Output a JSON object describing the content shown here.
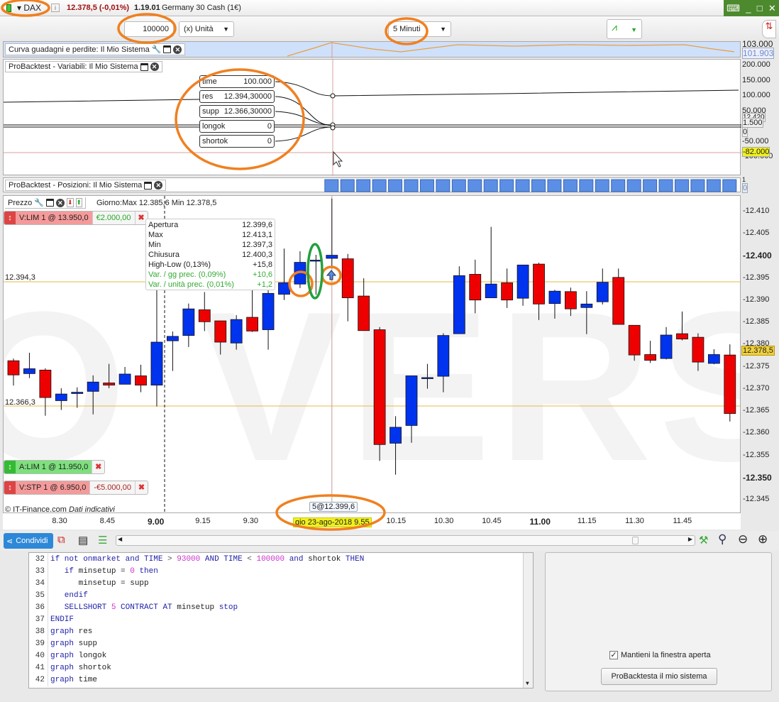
{
  "titlebar": {
    "instrument": "DAX",
    "price": "12.378,5 (-0,01%)",
    "time": "1.19.01",
    "description": "Germany 30 Cash (1€)"
  },
  "toolbar": {
    "quantity": "100000",
    "unit": "(x) Unità",
    "timeframe": "5 Minuti"
  },
  "equity_panel": {
    "title": "Curva guadagni e perdite: Il Mio Sistema",
    "axis_top": "103.000",
    "last_value": "101.903"
  },
  "variables_panel": {
    "title": "ProBacktest - Variabili: Il Mio Sistema",
    "vars": [
      {
        "name": "time",
        "value": "100.000"
      },
      {
        "name": "res",
        "value": "12.394,30000"
      },
      {
        "name": "supp",
        "value": "12.366,30000"
      },
      {
        "name": "longok",
        "value": "0"
      },
      {
        "name": "shortok",
        "value": "0"
      }
    ],
    "axis": [
      "200.000",
      "150.000",
      "100.000",
      "50.000",
      "-50.000",
      "-100.000"
    ],
    "boxes": {
      "a": "12.420",
      "b": "1.500",
      "c": "0",
      "cursor": "-82.000"
    }
  },
  "positions_panel": {
    "title": "ProBacktest - Posizioni: Il Mio Sistema",
    "axis_top": "1",
    "axis_box": "0"
  },
  "price_panel": {
    "title": "Prezzo",
    "day_info": "Giorno:Max 12.385,6 Min 12.378,5",
    "level_res": "12.394,3",
    "level_supp": "12.366,3",
    "orders": [
      {
        "label": "V:LIM  1 @ 13.950,0",
        "value": "€2.000,00"
      },
      {
        "label": "A:LIM  1 @ 11.950,0"
      },
      {
        "label": "V:STP  1 @ 6.950,0",
        "value": "-€5.000,00"
      }
    ],
    "tooltip": [
      {
        "k": "Apertura",
        "v": "12.399,6"
      },
      {
        "k": "Max",
        "v": "12.413,1"
      },
      {
        "k": "Min",
        "v": "12.397,3"
      },
      {
        "k": "Chiusura",
        "v": "12.400,3"
      },
      {
        "k": "High-Low (0,13%)",
        "v": "+15,8"
      },
      {
        "k": "Var. / gg prec. (0,09%)",
        "v": "+10,6"
      },
      {
        "k": "Var. / unità prec. (0,01%)",
        "v": "+1,2"
      }
    ],
    "copyright": "© IT-Finance.com",
    "disclaimer": "Dati indicativi",
    "order_marker": "5@12.399,6",
    "cursor_date": "gio 23-ago-2018 9.55",
    "last_price": "12.378,5",
    "watermark": "O VERSIO"
  },
  "chart_data": {
    "type": "candlestick",
    "ylim": [
      12343,
      12412
    ],
    "yticks": [
      "12.410",
      "12.405",
      "12.400",
      "12.395",
      "12.390",
      "12.385",
      "12.380",
      "12.375",
      "12.370",
      "12.365",
      "12.360",
      "12.355",
      "12.350",
      "12.345"
    ],
    "ytick_values": [
      12410,
      12405,
      12400,
      12395,
      12390,
      12385,
      12380,
      12375,
      12370,
      12365,
      12360,
      12355,
      12350,
      12345
    ],
    "xticks": [
      {
        "label": "8.30",
        "bar": 3
      },
      {
        "label": "8.45",
        "bar": 6
      },
      {
        "label": "9.00",
        "bar": 9,
        "bold": true
      },
      {
        "label": "9.15",
        "bar": 12
      },
      {
        "label": "9.30",
        "bar": 15
      },
      {
        "label": "10.15",
        "bar": 24
      },
      {
        "label": "10.30",
        "bar": 27
      },
      {
        "label": "10.45",
        "bar": 30
      },
      {
        "label": "11.00",
        "bar": 33,
        "bold": true
      },
      {
        "label": "11.15",
        "bar": 36
      },
      {
        "label": "11.30",
        "bar": 39
      },
      {
        "label": "11.45",
        "bar": 42
      }
    ],
    "ohlc": [
      [
        12376.5,
        12377.0,
        12370.9,
        12373.3
      ],
      [
        12373.6,
        12378.3,
        12372.6,
        12374.7
      ],
      [
        12374.4,
        12374.8,
        12364.1,
        12368.2
      ],
      [
        12367.5,
        12370.3,
        12365.4,
        12369.0
      ],
      [
        12369.1,
        12370.5,
        12365.9,
        12369.4
      ],
      [
        12369.6,
        12373.2,
        12364.4,
        12371.7
      ],
      [
        12371.5,
        12375.8,
        12370.3,
        12371.0
      ],
      [
        12371.2,
        12375.1,
        12371.2,
        12373.5
      ],
      [
        12373.1,
        12375.6,
        12369.4,
        12371.0
      ],
      [
        12371.0,
        12392.9,
        12366.2,
        12380.7
      ],
      [
        12381.0,
        12383.1,
        12374.2,
        12382.0
      ],
      [
        12382.2,
        12389.4,
        12379.6,
        12388.2
      ],
      [
        12388.0,
        12392.0,
        12383.2,
        12385.3
      ],
      [
        12385.5,
        12385.5,
        12377.9,
        12380.7
      ],
      [
        12380.5,
        12386.8,
        12379.0,
        12385.8
      ],
      [
        12386.3,
        12392.5,
        12383.0,
        12383.2
      ],
      [
        12383.5,
        12394.0,
        12379.0,
        12391.7
      ],
      [
        12391.5,
        12401.8,
        12390.2,
        12394.1
      ],
      [
        12393.8,
        12401.2,
        12392.9,
        12398.7
      ],
      [
        12399.0,
        12400.4,
        12391.4,
        12399.2
      ],
      [
        12399.6,
        12413.1,
        12397.3,
        12400.3
      ],
      [
        12399.5,
        12400.6,
        12385.4,
        12390.7
      ],
      [
        12391.1,
        12395.1,
        12383.3,
        12383.3
      ],
      [
        12383.5,
        12384.1,
        12353.9,
        12357.6
      ],
      [
        12357.9,
        12364.0,
        12350.8,
        12361.5
      ],
      [
        12361.9,
        12373.1,
        12358.0,
        12373.1
      ],
      [
        12372.7,
        12375.8,
        12370.2,
        12372.7
      ],
      [
        12373.0,
        12382.7,
        12369.4,
        12382.2
      ],
      [
        12382.6,
        12397.8,
        12382.6,
        12395.7
      ],
      [
        12396.0,
        12399.3,
        12387.2,
        12390.2
      ],
      [
        12390.7,
        12406.7,
        12390.7,
        12393.8
      ],
      [
        12394.1,
        12397.3,
        12388.4,
        12390.2
      ],
      [
        12390.6,
        12398.1,
        12388.9,
        12398.1
      ],
      [
        12398.3,
        12398.6,
        12385.7,
        12389.3
      ],
      [
        12389.4,
        12392.5,
        12386.0,
        12392.2
      ],
      [
        12392.1,
        12393.0,
        12386.6,
        12388.2
      ],
      [
        12388.5,
        12392.2,
        12382.5,
        12389.3
      ],
      [
        12389.8,
        12397.3,
        12389.2,
        12394.2
      ],
      [
        12395.3,
        12397.3,
        12384.7,
        12384.7
      ],
      [
        12384.5,
        12384.5,
        12376.5,
        12377.8
      ],
      [
        12377.9,
        12381.0,
        12376.0,
        12376.6
      ],
      [
        12377.0,
        12384.1,
        12376.8,
        12382.3
      ],
      [
        12382.6,
        12387.6,
        12381.1,
        12381.4
      ],
      [
        12381.8,
        12382.7,
        12374.2,
        12376.2
      ],
      [
        12375.9,
        12379.1,
        12375.7,
        12377.9
      ],
      [
        12377.8,
        12380.2,
        12362.8,
        12364.6
      ]
    ],
    "levels": {
      "res": 12394.3,
      "supp": 12366.3,
      "last": 12378.5
    },
    "colors": {
      "up": "#0033ee",
      "down": "#ee0000",
      "level": "#e8b84a"
    }
  },
  "bottom_toolbar": {
    "share": "Condividi"
  },
  "code": [
    {
      "n": "32",
      "t": [
        [
          "if",
          "kw"
        ],
        [
          " not onmarket ",
          "kw"
        ],
        [
          "and",
          "kw"
        ],
        [
          " TIME ",
          "kw"
        ],
        [
          "> ",
          "op"
        ],
        [
          "93000",
          "num"
        ],
        [
          " AND TIME ",
          "kw"
        ],
        [
          "< ",
          "op"
        ],
        [
          "100000",
          "num"
        ],
        [
          " and ",
          "kw"
        ],
        [
          "shortok ",
          "id"
        ],
        [
          "THEN",
          "kw"
        ]
      ]
    },
    {
      "n": "33",
      "t": [
        [
          "   if ",
          "kw"
        ],
        [
          "minsetup = ",
          "id"
        ],
        [
          "0",
          "num"
        ],
        [
          " then",
          "kw"
        ]
      ]
    },
    {
      "n": "34",
      "t": [
        [
          "      minsetup = supp",
          "id"
        ]
      ]
    },
    {
      "n": "35",
      "t": [
        [
          "   endif",
          "kw"
        ]
      ]
    },
    {
      "n": "36",
      "t": [
        [
          "   SELLSHORT ",
          "kw"
        ],
        [
          "5",
          "num"
        ],
        [
          " CONTRACT AT ",
          "kw"
        ],
        [
          "minsetup ",
          "id"
        ],
        [
          "stop",
          "kw"
        ]
      ]
    },
    {
      "n": "37",
      "t": [
        [
          "ENDIF",
          "kw"
        ]
      ]
    },
    {
      "n": "38",
      "t": [
        [
          "graph ",
          "kw"
        ],
        [
          "res",
          "id"
        ]
      ]
    },
    {
      "n": "39",
      "t": [
        [
          "graph ",
          "kw"
        ],
        [
          "supp",
          "id"
        ]
      ]
    },
    {
      "n": "40",
      "t": [
        [
          "graph ",
          "kw"
        ],
        [
          "longok",
          "id"
        ]
      ]
    },
    {
      "n": "41",
      "t": [
        [
          "graph ",
          "kw"
        ],
        [
          "shortok",
          "id"
        ]
      ]
    },
    {
      "n": "42",
      "t": [
        [
          "graph ",
          "kw"
        ],
        [
          "time",
          "id"
        ]
      ]
    }
  ],
  "right_pane": {
    "keep_open": "Mantieni la finestra aperta",
    "keep_open_checked": true,
    "run_button": "ProBacktesta il mio sistema"
  }
}
